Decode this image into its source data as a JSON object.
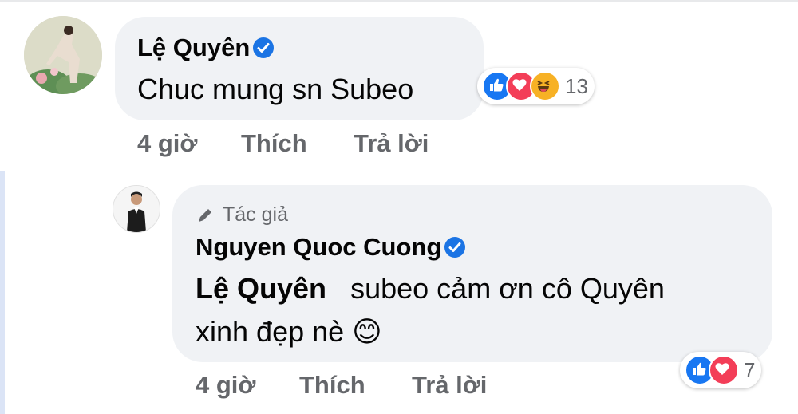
{
  "comment": {
    "author": "Lệ Quyên",
    "text": "Chuc mung sn Subeo",
    "time": "4 giờ",
    "like_label": "Thích",
    "reply_label": "Trả lời",
    "reaction_count": "13",
    "reactions": [
      "like-icon",
      "love-icon",
      "haha-icon"
    ]
  },
  "reply": {
    "author_tag": "Tác giả",
    "author": "Nguyen Quoc Cuong",
    "mention": "Lệ Quyên",
    "text_line1": "subeo cảm ơn cô Quyên",
    "text_line2": "xinh đẹp nè",
    "emoji": "😊",
    "time": "4 giờ",
    "like_label": "Thích",
    "reply_label": "Trả lời",
    "reaction_count": "7",
    "reactions": [
      "like-icon",
      "love-icon"
    ]
  },
  "colors": {
    "bubble": "#f0f2f5",
    "meta_text": "#65676b",
    "verified": "#1b74e4",
    "like": "#1877f2",
    "love": "#f33e58",
    "haha": "#f7b125",
    "thread_line": "#dbe4f6"
  }
}
